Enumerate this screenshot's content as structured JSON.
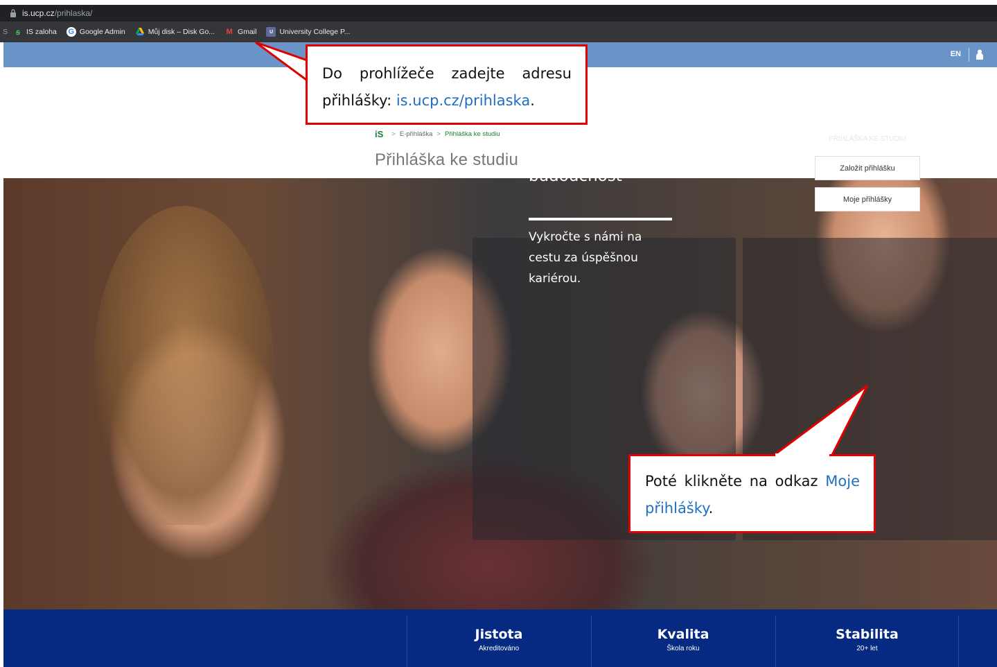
{
  "browser": {
    "url_host": "is.ucp.cz",
    "url_path": "/prihlaska/",
    "bookmarks": [
      {
        "label": "IS zaloha",
        "icon": "is-logo-icon"
      },
      {
        "label": "Google Admin",
        "icon": "google-icon"
      },
      {
        "label": "Můj disk – Disk Go...",
        "icon": "google-drive-icon"
      },
      {
        "label": "Gmail",
        "icon": "gmail-icon"
      },
      {
        "label": "University College P...",
        "icon": "ucp-icon"
      }
    ],
    "bookmark_stub": "S"
  },
  "header": {
    "lang": "EN",
    "bar_color": "#6a93c7"
  },
  "breadcrumb": {
    "logo": "iS",
    "items": [
      "E-přihláška",
      "Přihláška ke studiu"
    ]
  },
  "page_title": "Přihláška ke studiu",
  "hero": {
    "title": "Volba, která mění budoucnost",
    "subtitle": "Vykročte s námi na cestu za úspěšnou kariérou.",
    "apply_heading": "PŘIHLÁŠKA KE STUDIU",
    "btn_create": "Založit přihlášku",
    "btn_mine": "Moje přihlášky"
  },
  "footer": {
    "color": "#062a82",
    "items": [
      {
        "title": "Jistota",
        "sub": "Akreditováno"
      },
      {
        "title": "Kvalita",
        "sub": "Škola roku"
      },
      {
        "title": "Stabilita",
        "sub": "20+ let"
      }
    ]
  },
  "callouts": {
    "one_text": "Do prohlížeče zadejte adresu přihlášky: ",
    "one_link": "is.ucp.cz/prihlaska",
    "one_end": ".",
    "two_text": "Poté klikněte na odkaz ",
    "two_link": "Moje přihlášky",
    "two_end": ".",
    "border_color": "#e00000"
  }
}
